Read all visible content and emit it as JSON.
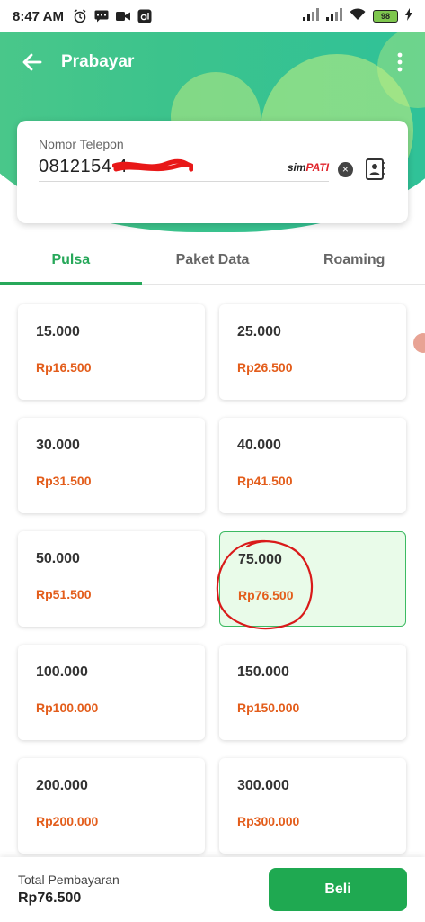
{
  "status_bar": {
    "time": "8:47 AM",
    "battery": "98"
  },
  "app_bar": {
    "title": "Prabayar"
  },
  "phone": {
    "label": "Nomor Telepon",
    "value": "0812154 4",
    "operator_prefix": "sim",
    "operator_accent": "PATI"
  },
  "tabs": [
    {
      "label": "Pulsa",
      "active": true
    },
    {
      "label": "Paket Data",
      "active": false
    },
    {
      "label": "Roaming",
      "active": false
    }
  ],
  "denominations": [
    {
      "nominal": "15.000",
      "price": "Rp16.500"
    },
    {
      "nominal": "25.000",
      "price": "Rp26.500"
    },
    {
      "nominal": "30.000",
      "price": "Rp31.500"
    },
    {
      "nominal": "40.000",
      "price": "Rp41.500"
    },
    {
      "nominal": "50.000",
      "price": "Rp51.500"
    },
    {
      "nominal": "75.000",
      "price": "Rp76.500",
      "selected": true
    },
    {
      "nominal": "100.000",
      "price": "Rp100.000"
    },
    {
      "nominal": "150.000",
      "price": "Rp150.000"
    },
    {
      "nominal": "200.000",
      "price": "Rp200.000"
    },
    {
      "nominal": "300.000",
      "price": "Rp300.000"
    }
  ],
  "footer": {
    "total_label": "Total Pembayaran",
    "total_value": "Rp76.500",
    "buy_label": "Beli"
  },
  "colors": {
    "accent_green": "#27a85a",
    "price_orange": "#e35d1b",
    "selected_bg": "#e9fbe9",
    "button_green": "#1fa951"
  },
  "icons": [
    "back-arrow-icon",
    "more-vertical-icon",
    "clear-icon",
    "contacts-icon",
    "alarm-icon",
    "message-icon",
    "video-icon",
    "signal-icon",
    "wifi-icon",
    "battery-icon",
    "charging-icon"
  ]
}
